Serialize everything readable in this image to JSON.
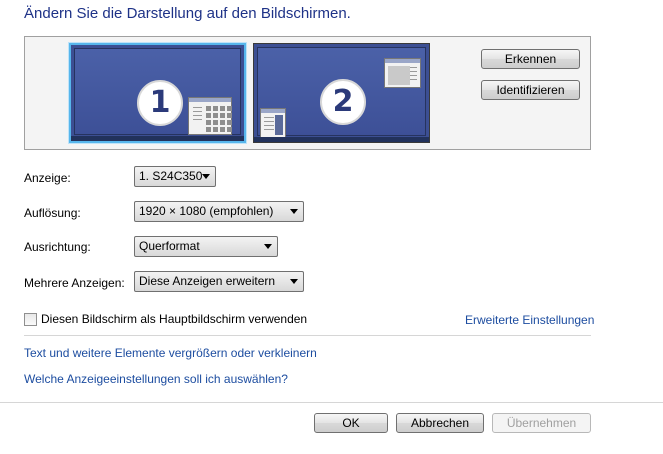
{
  "header": {
    "title": "Ändern Sie die Darstellung auf den Bildschirmen."
  },
  "monitors": {
    "monitor_1": {
      "number": "1",
      "selected": true
    },
    "monitor_2": {
      "number": "2",
      "selected": false
    }
  },
  "panel_buttons": {
    "detect_label": "Erkennen",
    "identify_label": "Identifizieren"
  },
  "settings": {
    "display": {
      "label": "Anzeige:",
      "value": "1. S24C350"
    },
    "resolution": {
      "label": "Auflösung:",
      "value": "1920 × 1080 (empfohlen)"
    },
    "orientation": {
      "label": "Ausrichtung:",
      "value": "Querformat"
    },
    "multiple_displays": {
      "label": "Mehrere Anzeigen:",
      "value": "Diese Anzeigen erweitern"
    }
  },
  "main_display_checkbox": {
    "label": "Diesen Bildschirm als Hauptbildschirm verwenden",
    "checked": false
  },
  "links": {
    "advanced_settings": "Erweiterte Einstellungen",
    "text_size": "Text und weitere Elemente vergrößern oder verkleinern",
    "which_settings": "Welche Anzeigeeinstellungen soll ich auswählen?"
  },
  "footer": {
    "ok_label": "OK",
    "cancel_label": "Abbrechen",
    "apply_label": "Übernehmen",
    "apply_enabled": false
  },
  "colors": {
    "title": "#1e3287",
    "link": "#1d4da0",
    "monitor": "#3d5097",
    "selection": "#57b6ec"
  },
  "icons": [
    "window-grid-icon",
    "window-small-icon"
  ]
}
